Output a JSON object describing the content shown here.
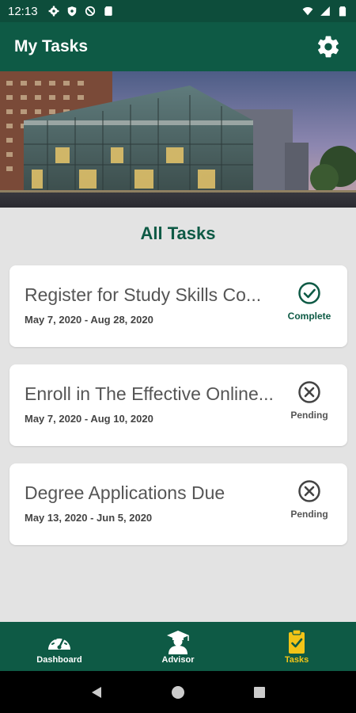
{
  "status_bar": {
    "time": "12:13"
  },
  "app_bar": {
    "title": "My Tasks"
  },
  "section": {
    "title": "All Tasks"
  },
  "tasks": [
    {
      "title": "Register for Study Skills Co...",
      "dates": "May 7, 2020 - Aug 28, 2020",
      "status": "Complete"
    },
    {
      "title": "Enroll in The Effective Online...",
      "dates": "May 7, 2020 - Aug 10, 2020",
      "status": "Pending"
    },
    {
      "title": "Degree Applications Due",
      "dates": "May 13, 2020 - Jun 5, 2020",
      "status": "Pending"
    }
  ],
  "bottom_nav": {
    "items": [
      {
        "label": "Dashboard",
        "icon": "gauge-icon"
      },
      {
        "label": "Advisor",
        "icon": "graduate-icon"
      },
      {
        "label": "Tasks",
        "icon": "clipboard-check-icon",
        "active": true
      }
    ]
  },
  "colors": {
    "primary": "#0e5a45",
    "status_bar": "#0d4d3b",
    "accent": "#f2c417",
    "background": "#e3e3e3"
  }
}
